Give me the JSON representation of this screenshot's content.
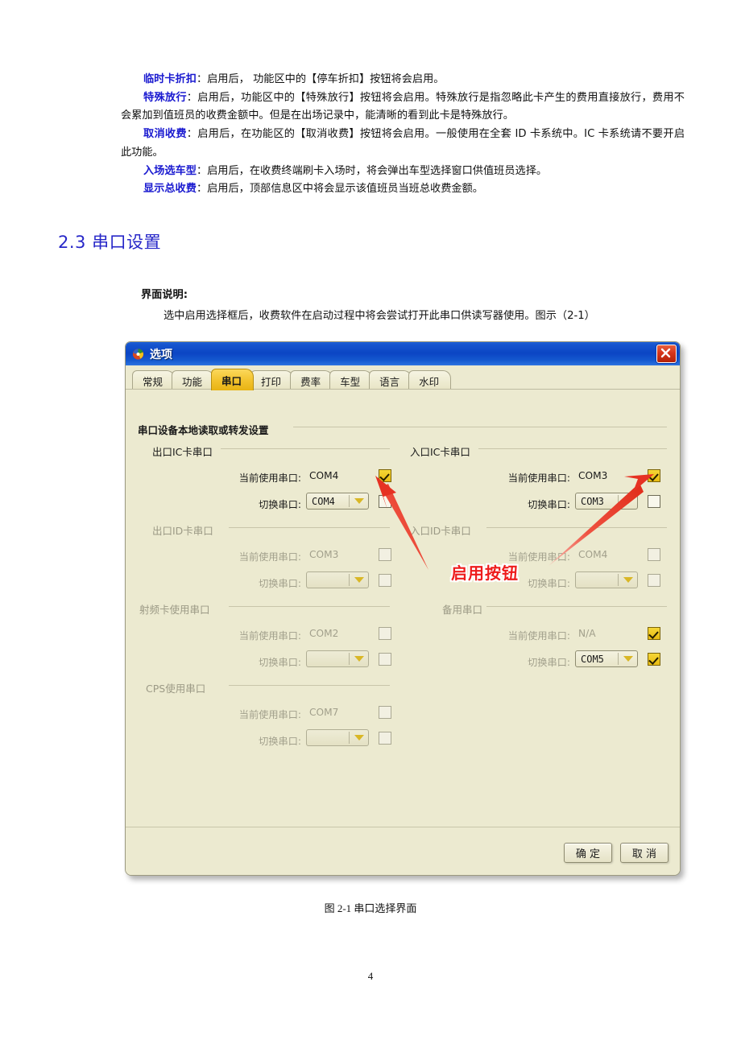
{
  "document": {
    "paragraphs": [
      {
        "lead": "临时卡折扣",
        "text": "：启用后， 功能区中的【停车折扣】按钮将会启用。"
      },
      {
        "lead": "特殊放行",
        "text": "：启用后，功能区中的【特殊放行】按钮将会启用。特殊放行是指忽略此卡产生的费用直接放行，费用不会累加到值班员的收费金额中。但是在出场记录中，能清晰的看到此卡是特殊放行。"
      },
      {
        "lead": "取消收费",
        "text": "：启用后，在功能区的【取消收费】按钮将会启用。一般使用在全套 ID 卡系统中。IC 卡系统请不要开启此功能。"
      },
      {
        "lead": "入场选车型",
        "text": "：启用后，在收费终端刷卡入场时，将会弹出车型选择窗口供值班员选择。"
      },
      {
        "lead": "显示总收费",
        "text": "：启用后，顶部信息区中将会显示该值班员当班总收费金额。"
      }
    ],
    "section_heading": "2.3 串口设置",
    "interface_label": "界面说明:",
    "interface_text": "选中启用选择框后，收费软件在启动过程中将会尝试打开此串口供读写器使用。图示（2-1）",
    "figure_caption": "图 2-1  串口选择界面",
    "page_number": "4"
  },
  "dialog": {
    "title": "选项",
    "close_label": "×",
    "tabs": [
      {
        "label": "常规",
        "active": false
      },
      {
        "label": "功能",
        "active": false
      },
      {
        "label": "串口",
        "active": true
      },
      {
        "label": "打印",
        "active": false
      },
      {
        "label": "费率",
        "active": false
      },
      {
        "label": "车型",
        "active": false
      },
      {
        "label": "语言",
        "active": false
      },
      {
        "label": "水印",
        "active": false
      }
    ],
    "main_group_title": "串口设备本地读取或转发设置",
    "field_labels": {
      "current": "当前使用串口:",
      "switch": "切换串口:"
    },
    "groups": [
      {
        "id": "exit-ic",
        "title": "出口IC卡串口",
        "enabled": true,
        "current_value": "COM4",
        "current_checked": true,
        "switch_value": "COM4",
        "switch_checked": false
      },
      {
        "id": "entry-ic",
        "title": "入口IC卡串口",
        "enabled": true,
        "current_value": "COM3",
        "current_checked": true,
        "switch_value": "COM3",
        "switch_checked": false
      },
      {
        "id": "exit-id",
        "title": "出口ID卡串口",
        "enabled": false,
        "current_value": "COM3",
        "current_checked": false,
        "switch_value": "",
        "switch_checked": false
      },
      {
        "id": "entry-id",
        "title": "入口ID卡串口",
        "enabled": false,
        "current_value": "COM4",
        "current_checked": false,
        "switch_value": "",
        "switch_checked": false
      },
      {
        "id": "rf-card",
        "title": "射频卡使用串口",
        "enabled": false,
        "current_value": "COM2",
        "current_checked": false,
        "switch_value": "",
        "switch_checked": false
      },
      {
        "id": "spare",
        "title": "备用串口",
        "enabled": false,
        "current_value": "N/A",
        "current_checked": true,
        "switch_value": "COM5",
        "switch_checked": true
      },
      {
        "id": "cps",
        "title": "CPS使用串口",
        "enabled": false,
        "current_value": "COM7",
        "current_checked": false,
        "switch_value": "",
        "switch_checked": false
      }
    ],
    "buttons": {
      "ok": "确 定",
      "cancel": "取 消"
    }
  },
  "annotations": {
    "callout_text": "启用按钮",
    "callout_color": "#ee1c1c"
  },
  "colors": {
    "heading": "#2727c8",
    "lead": "#1a1ad0",
    "dialog_bg": "#ecead0",
    "titlebar": "#0b45c4",
    "active_tab": "#f2c22c",
    "checkbox_checked": "#e8bb12"
  }
}
